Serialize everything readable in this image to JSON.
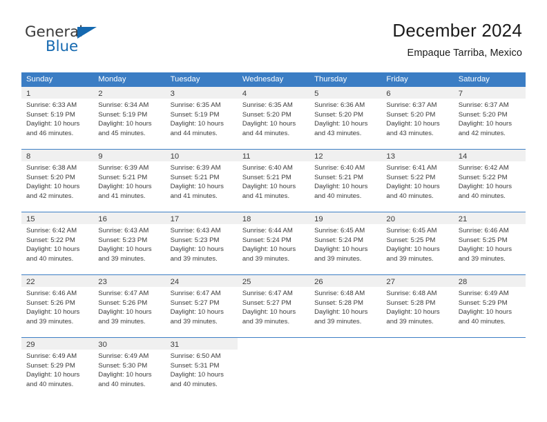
{
  "brand": {
    "name_part1": "General",
    "name_part2": "Blue",
    "triangle_color": "#1569b0"
  },
  "header": {
    "title": "December 2024",
    "subtitle": "Empaque Tarriba, Mexico"
  },
  "theme": {
    "header_blue": "#3b7dc4",
    "day_band_gray": "#f0f0f0",
    "text_color": "#3a3a3a"
  },
  "weekdays": [
    "Sunday",
    "Monday",
    "Tuesday",
    "Wednesday",
    "Thursday",
    "Friday",
    "Saturday"
  ],
  "weeks": [
    [
      {
        "day": "1",
        "sunrise": "Sunrise: 6:33 AM",
        "sunset": "Sunset: 5:19 PM",
        "daylight_line1": "Daylight: 10 hours",
        "daylight_line2": "and 46 minutes."
      },
      {
        "day": "2",
        "sunrise": "Sunrise: 6:34 AM",
        "sunset": "Sunset: 5:19 PM",
        "daylight_line1": "Daylight: 10 hours",
        "daylight_line2": "and 45 minutes."
      },
      {
        "day": "3",
        "sunrise": "Sunrise: 6:35 AM",
        "sunset": "Sunset: 5:19 PM",
        "daylight_line1": "Daylight: 10 hours",
        "daylight_line2": "and 44 minutes."
      },
      {
        "day": "4",
        "sunrise": "Sunrise: 6:35 AM",
        "sunset": "Sunset: 5:20 PM",
        "daylight_line1": "Daylight: 10 hours",
        "daylight_line2": "and 44 minutes."
      },
      {
        "day": "5",
        "sunrise": "Sunrise: 6:36 AM",
        "sunset": "Sunset: 5:20 PM",
        "daylight_line1": "Daylight: 10 hours",
        "daylight_line2": "and 43 minutes."
      },
      {
        "day": "6",
        "sunrise": "Sunrise: 6:37 AM",
        "sunset": "Sunset: 5:20 PM",
        "daylight_line1": "Daylight: 10 hours",
        "daylight_line2": "and 43 minutes."
      },
      {
        "day": "7",
        "sunrise": "Sunrise: 6:37 AM",
        "sunset": "Sunset: 5:20 PM",
        "daylight_line1": "Daylight: 10 hours",
        "daylight_line2": "and 42 minutes."
      }
    ],
    [
      {
        "day": "8",
        "sunrise": "Sunrise: 6:38 AM",
        "sunset": "Sunset: 5:20 PM",
        "daylight_line1": "Daylight: 10 hours",
        "daylight_line2": "and 42 minutes."
      },
      {
        "day": "9",
        "sunrise": "Sunrise: 6:39 AM",
        "sunset": "Sunset: 5:21 PM",
        "daylight_line1": "Daylight: 10 hours",
        "daylight_line2": "and 41 minutes."
      },
      {
        "day": "10",
        "sunrise": "Sunrise: 6:39 AM",
        "sunset": "Sunset: 5:21 PM",
        "daylight_line1": "Daylight: 10 hours",
        "daylight_line2": "and 41 minutes."
      },
      {
        "day": "11",
        "sunrise": "Sunrise: 6:40 AM",
        "sunset": "Sunset: 5:21 PM",
        "daylight_line1": "Daylight: 10 hours",
        "daylight_line2": "and 41 minutes."
      },
      {
        "day": "12",
        "sunrise": "Sunrise: 6:40 AM",
        "sunset": "Sunset: 5:21 PM",
        "daylight_line1": "Daylight: 10 hours",
        "daylight_line2": "and 40 minutes."
      },
      {
        "day": "13",
        "sunrise": "Sunrise: 6:41 AM",
        "sunset": "Sunset: 5:22 PM",
        "daylight_line1": "Daylight: 10 hours",
        "daylight_line2": "and 40 minutes."
      },
      {
        "day": "14",
        "sunrise": "Sunrise: 6:42 AM",
        "sunset": "Sunset: 5:22 PM",
        "daylight_line1": "Daylight: 10 hours",
        "daylight_line2": "and 40 minutes."
      }
    ],
    [
      {
        "day": "15",
        "sunrise": "Sunrise: 6:42 AM",
        "sunset": "Sunset: 5:22 PM",
        "daylight_line1": "Daylight: 10 hours",
        "daylight_line2": "and 40 minutes."
      },
      {
        "day": "16",
        "sunrise": "Sunrise: 6:43 AM",
        "sunset": "Sunset: 5:23 PM",
        "daylight_line1": "Daylight: 10 hours",
        "daylight_line2": "and 39 minutes."
      },
      {
        "day": "17",
        "sunrise": "Sunrise: 6:43 AM",
        "sunset": "Sunset: 5:23 PM",
        "daylight_line1": "Daylight: 10 hours",
        "daylight_line2": "and 39 minutes."
      },
      {
        "day": "18",
        "sunrise": "Sunrise: 6:44 AM",
        "sunset": "Sunset: 5:24 PM",
        "daylight_line1": "Daylight: 10 hours",
        "daylight_line2": "and 39 minutes."
      },
      {
        "day": "19",
        "sunrise": "Sunrise: 6:45 AM",
        "sunset": "Sunset: 5:24 PM",
        "daylight_line1": "Daylight: 10 hours",
        "daylight_line2": "and 39 minutes."
      },
      {
        "day": "20",
        "sunrise": "Sunrise: 6:45 AM",
        "sunset": "Sunset: 5:25 PM",
        "daylight_line1": "Daylight: 10 hours",
        "daylight_line2": "and 39 minutes."
      },
      {
        "day": "21",
        "sunrise": "Sunrise: 6:46 AM",
        "sunset": "Sunset: 5:25 PM",
        "daylight_line1": "Daylight: 10 hours",
        "daylight_line2": "and 39 minutes."
      }
    ],
    [
      {
        "day": "22",
        "sunrise": "Sunrise: 6:46 AM",
        "sunset": "Sunset: 5:26 PM",
        "daylight_line1": "Daylight: 10 hours",
        "daylight_line2": "and 39 minutes."
      },
      {
        "day": "23",
        "sunrise": "Sunrise: 6:47 AM",
        "sunset": "Sunset: 5:26 PM",
        "daylight_line1": "Daylight: 10 hours",
        "daylight_line2": "and 39 minutes."
      },
      {
        "day": "24",
        "sunrise": "Sunrise: 6:47 AM",
        "sunset": "Sunset: 5:27 PM",
        "daylight_line1": "Daylight: 10 hours",
        "daylight_line2": "and 39 minutes."
      },
      {
        "day": "25",
        "sunrise": "Sunrise: 6:47 AM",
        "sunset": "Sunset: 5:27 PM",
        "daylight_line1": "Daylight: 10 hours",
        "daylight_line2": "and 39 minutes."
      },
      {
        "day": "26",
        "sunrise": "Sunrise: 6:48 AM",
        "sunset": "Sunset: 5:28 PM",
        "daylight_line1": "Daylight: 10 hours",
        "daylight_line2": "and 39 minutes."
      },
      {
        "day": "27",
        "sunrise": "Sunrise: 6:48 AM",
        "sunset": "Sunset: 5:28 PM",
        "daylight_line1": "Daylight: 10 hours",
        "daylight_line2": "and 39 minutes."
      },
      {
        "day": "28",
        "sunrise": "Sunrise: 6:49 AM",
        "sunset": "Sunset: 5:29 PM",
        "daylight_line1": "Daylight: 10 hours",
        "daylight_line2": "and 40 minutes."
      }
    ],
    [
      {
        "day": "29",
        "sunrise": "Sunrise: 6:49 AM",
        "sunset": "Sunset: 5:29 PM",
        "daylight_line1": "Daylight: 10 hours",
        "daylight_line2": "and 40 minutes."
      },
      {
        "day": "30",
        "sunrise": "Sunrise: 6:49 AM",
        "sunset": "Sunset: 5:30 PM",
        "daylight_line1": "Daylight: 10 hours",
        "daylight_line2": "and 40 minutes."
      },
      {
        "day": "31",
        "sunrise": "Sunrise: 6:50 AM",
        "sunset": "Sunset: 5:31 PM",
        "daylight_line1": "Daylight: 10 hours",
        "daylight_line2": "and 40 minutes."
      },
      {
        "day": "",
        "sunrise": "",
        "sunset": "",
        "daylight_line1": "",
        "daylight_line2": ""
      },
      {
        "day": "",
        "sunrise": "",
        "sunset": "",
        "daylight_line1": "",
        "daylight_line2": ""
      },
      {
        "day": "",
        "sunrise": "",
        "sunset": "",
        "daylight_line1": "",
        "daylight_line2": ""
      },
      {
        "day": "",
        "sunrise": "",
        "sunset": "",
        "daylight_line1": "",
        "daylight_line2": ""
      }
    ]
  ]
}
